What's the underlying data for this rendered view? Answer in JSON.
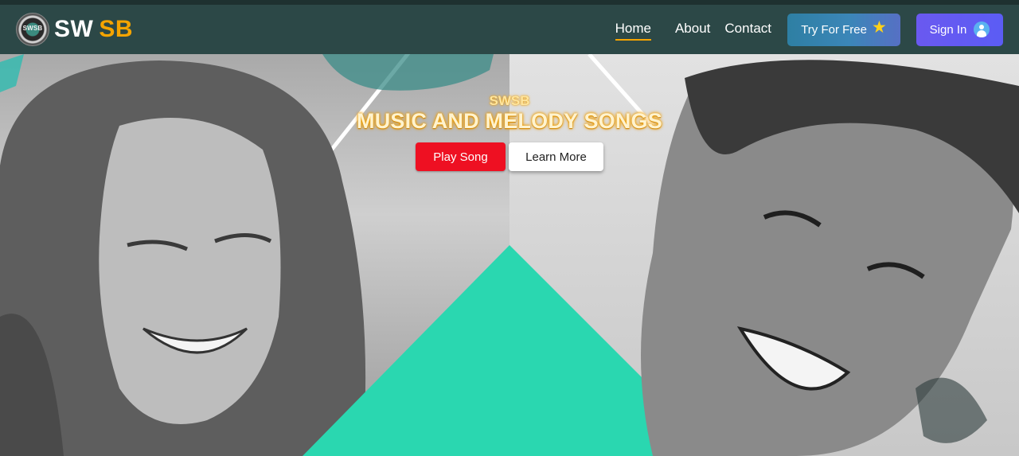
{
  "logo": {
    "badge_text": "SWSB",
    "text_primary": "SW",
    "text_accent": "SB",
    "accent_color": "#f5a400"
  },
  "nav": {
    "links": [
      {
        "label": "Home",
        "active": true
      },
      {
        "label": "About",
        "active": false
      },
      {
        "label": "Contact",
        "active": false
      }
    ],
    "try_button": {
      "label": "Try For Free",
      "icon": "star-icon"
    },
    "signin_button": {
      "label": "Sign In",
      "icon": "user-icon"
    }
  },
  "hero": {
    "kicker": "SWSB",
    "title": "MUSIC AND MELODY SONGS",
    "play_button": "Play Song",
    "learn_button": "Learn More"
  },
  "colors": {
    "navbar": "#2c4847",
    "play": "#ee1022",
    "signin": "#6a59f0",
    "teal_shape": "#2ad7b0"
  }
}
